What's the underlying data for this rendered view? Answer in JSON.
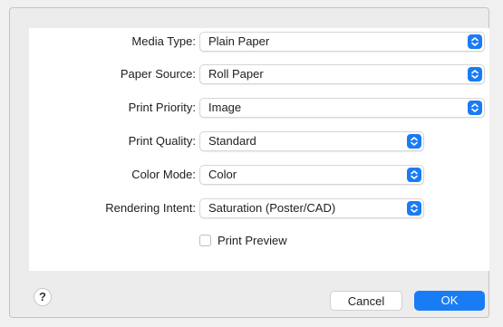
{
  "settings": [
    {
      "label": "Media Type:",
      "value": "Plain Paper"
    },
    {
      "label": "Paper Source:",
      "value": "Roll Paper"
    },
    {
      "label": "Print Priority:",
      "value": "Image"
    },
    {
      "label": "Print Quality:",
      "value": "Standard"
    },
    {
      "label": "Color Mode:",
      "value": "Color"
    },
    {
      "label": "Rendering Intent:",
      "value": "Saturation (Poster/CAD)"
    }
  ],
  "print_preview": {
    "label": "Print Preview",
    "checked": false
  },
  "help": {
    "label": "?"
  },
  "buttons": {
    "cancel": "Cancel",
    "ok": "OK"
  },
  "colors": {
    "accent": "#1a7cf5",
    "panel": "#ffffff",
    "window": "#ececec"
  },
  "icons": {
    "popup": "chevron-updown-icon",
    "help": "help-icon"
  }
}
